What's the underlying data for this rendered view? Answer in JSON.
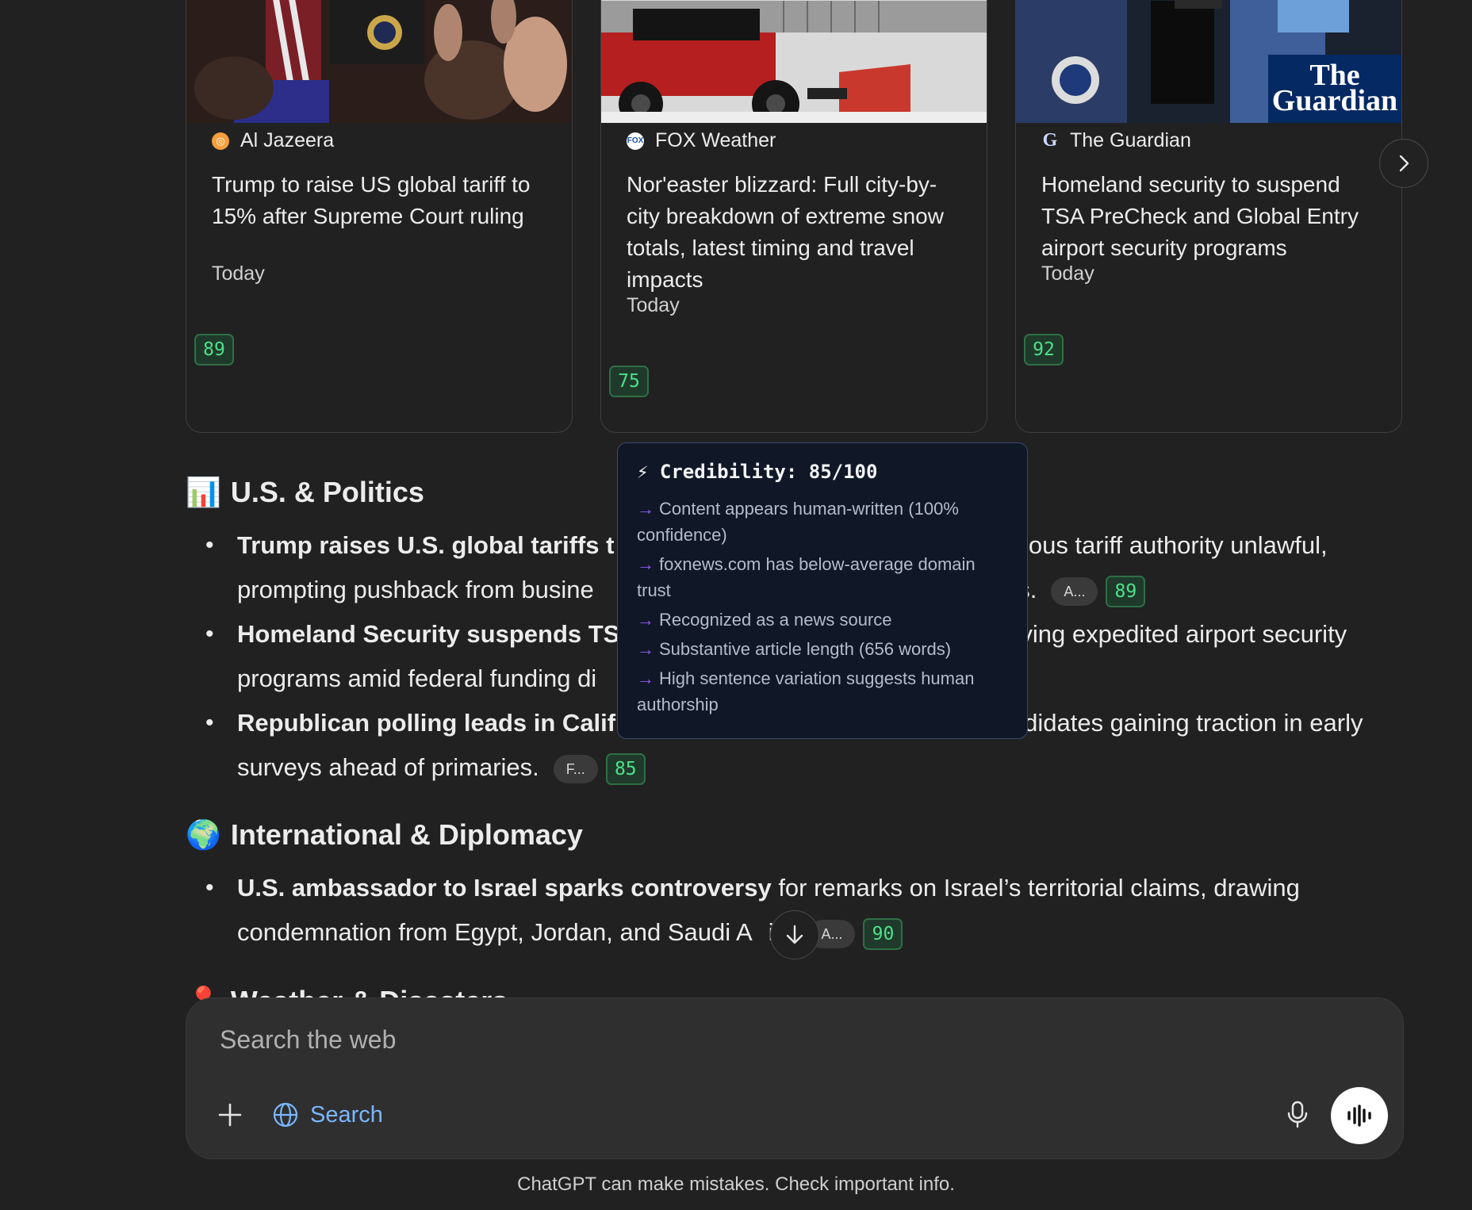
{
  "cards": [
    {
      "source": "Al Jazeera",
      "title": "Trump to raise US global tariff to 15% after Supreme Court ruling",
      "date": "Today",
      "score": "89",
      "icon": "al-jazeera-icon",
      "icon_color": "#f59e3b"
    },
    {
      "source": "FOX Weather",
      "title": "Nor'easter blizzard: Full city-by-city breakdown of extreme snow totals, latest timing and travel impacts",
      "date": "Today",
      "score": "75",
      "icon": "fox-icon",
      "icon_color": "#1f4fa3"
    },
    {
      "source": "The Guardian",
      "title": "Homeland security to suspend TSA PreCheck and Global Entry airport security programs",
      "date": "Today",
      "score": "92",
      "icon": "guardian-icon",
      "icon_color": "#0b2a5a",
      "thumb_logo": "The\nGuardian"
    }
  ],
  "sections": {
    "politics": {
      "emoji": "📊",
      "heading": "U.S. & Politics",
      "items": [
        {
          "bold": "Trump raises U.S. global tariffs t",
          "rest_a": "",
          "rest_b": "vious tariff authority unlawful,",
          "line2": "prompting pushback from busine",
          "line2_b": "nds.",
          "chip": "A...",
          "score": "89"
        },
        {
          "bold": "Homeland Security suspends TS",
          "rest_b": "ving expedited airport security",
          "line2": "programs amid federal funding di",
          "line2_b": "",
          "chip": "",
          "score": ""
        },
        {
          "bold": "Republican polling leads in Calif",
          "rest_b": "didates gaining traction in early",
          "line2": "surveys ahead of primaries.",
          "line2_b": "",
          "chip": "F...",
          "score": "85"
        }
      ]
    },
    "international": {
      "emoji": "🌍",
      "heading": "International & Diplomacy",
      "items": [
        {
          "bold": "U.S. ambassador to Israel sparks controversy",
          "rest": " for remarks on Israel’s territorial claims, drawing",
          "line2": "condemnation from Egypt, Jordan, and Saudi A",
          "line2_b": "ia.",
          "chip": "A...",
          "score": "90"
        }
      ]
    },
    "next": {
      "emoji": "📍",
      "heading": "Weather & Disasters"
    }
  },
  "tooltip": {
    "title": "⚡ Credibility: 85/100",
    "reasons": [
      "Content appears human-written (100% confidence)",
      "foxnews.com has below-average domain trust",
      "Recognized as a news source",
      "Substantive article length (656 words)",
      "High sentence variation suggests human authorship"
    ]
  },
  "composer": {
    "placeholder": "Search the web",
    "search_label": "Search"
  },
  "disclaimer": "ChatGPT can make mistakes. Check important info."
}
